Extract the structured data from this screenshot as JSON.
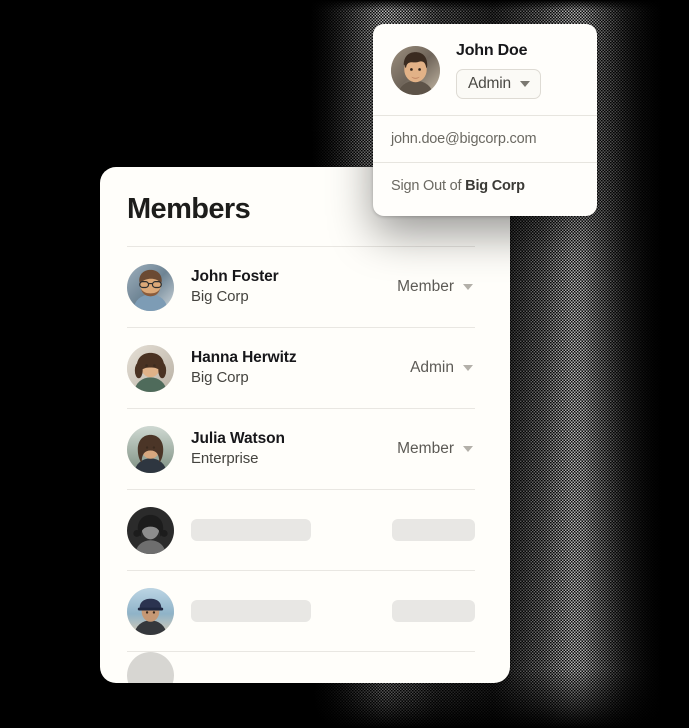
{
  "background": {
    "base_color": "#000000",
    "blob_color": "#111111",
    "texture": "dithered-noise"
  },
  "colors": {
    "card_surface": "#fffefa",
    "text_primary": "#17171a",
    "text_secondary": "#5c5a55",
    "divider": "#e9e7e2",
    "skeleton": "#e8e7e4",
    "caret": "#b3b0a9"
  },
  "members_panel": {
    "title": "Members",
    "rows": [
      {
        "avatar_icon": "avatar-john-foster",
        "name": "John Foster",
        "org": "Big Corp",
        "role": "Member",
        "caret_icon": "chevron-down-icon",
        "type": "member"
      },
      {
        "avatar_icon": "avatar-hanna-herwitz",
        "name": "Hanna Herwitz",
        "org": "Big Corp",
        "role": "Admin",
        "caret_icon": "chevron-down-icon",
        "type": "member"
      },
      {
        "avatar_icon": "avatar-julia-watson",
        "name": "Julia Watson",
        "org": "Enterprise",
        "role": "Member",
        "caret_icon": "chevron-down-icon",
        "type": "member"
      },
      {
        "avatar_icon": "avatar-loading-1",
        "name": "",
        "org": "",
        "role": "",
        "type": "skeleton"
      },
      {
        "avatar_icon": "avatar-loading-2",
        "name": "",
        "org": "",
        "role": "",
        "type": "skeleton"
      },
      {
        "avatar_icon": "avatar-loading-3",
        "name": "",
        "org": "",
        "role": "",
        "type": "partial"
      }
    ]
  },
  "account_popup": {
    "avatar_icon": "avatar-john-doe",
    "name": "John Doe",
    "role_button": {
      "label": "Admin",
      "caret_icon": "chevron-down-icon"
    },
    "email": "john.doe@bigcorp.com",
    "sign_out": {
      "prefix": "Sign Out of ",
      "org": "Big Corp"
    }
  }
}
